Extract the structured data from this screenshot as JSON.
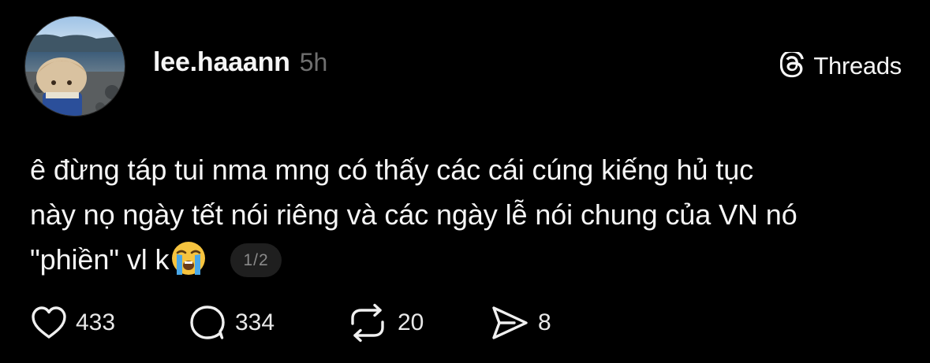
{
  "post": {
    "username": "lee.haaann",
    "time": "5h",
    "text_lines": [
      "ê đừng táp tui nma mng có thấy các cái cúng kiếng hủ tục",
      "này nọ ngày tết nói riêng và các ngày lễ nói chung của VN nó",
      "\"phiền\" vl k"
    ],
    "emoji": "loudly-crying-face",
    "page_indicator": "1/2"
  },
  "brand": {
    "label": "Threads",
    "icon": "threads-logo-icon"
  },
  "actions": {
    "likes": "433",
    "comments": "334",
    "reposts": "20",
    "shares": "8"
  },
  "colors": {
    "background": "#000000",
    "text": "#f5f5f5",
    "muted": "#6f6f6f",
    "pill_bg": "#1f1f1f"
  }
}
